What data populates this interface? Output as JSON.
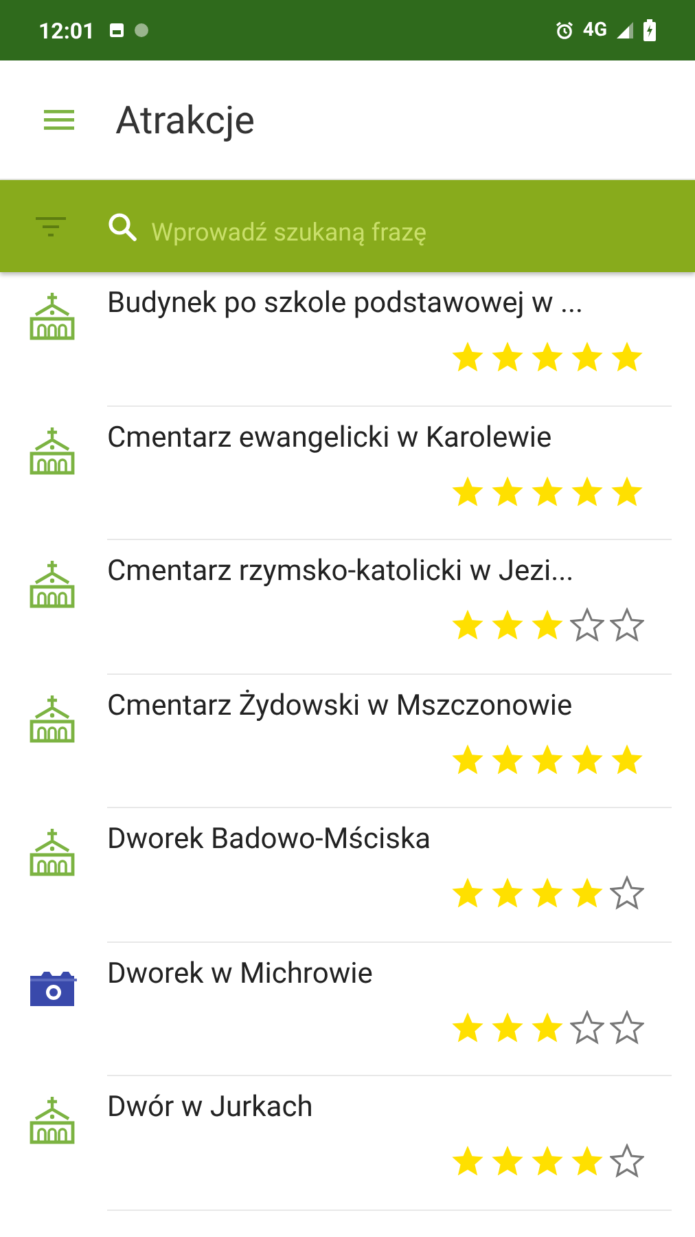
{
  "status_bar": {
    "time": "12:01",
    "network": "4G"
  },
  "app_bar": {
    "title": "Atrakcje"
  },
  "search": {
    "placeholder": "Wprowadź szukaną frazę"
  },
  "items": [
    {
      "kind": "church",
      "name": "Budynek po szkole podstawowej w ...",
      "stars": 5
    },
    {
      "kind": "church",
      "name": "Cmentarz ewangelicki w Karolewie",
      "stars": 5
    },
    {
      "kind": "church",
      "name": "Cmentarz rzymsko-katolicki w Jezi...",
      "stars": 3
    },
    {
      "kind": "church",
      "name": "Cmentarz Żydowski w Mszczonowie",
      "stars": 5
    },
    {
      "kind": "church",
      "name": "Dworek Badowo-Mściska",
      "stars": 4
    },
    {
      "kind": "camera",
      "name": "Dworek w Michrowie",
      "stars": 3
    },
    {
      "kind": "church",
      "name": "Dwór w Jurkach",
      "stars": 4
    }
  ]
}
